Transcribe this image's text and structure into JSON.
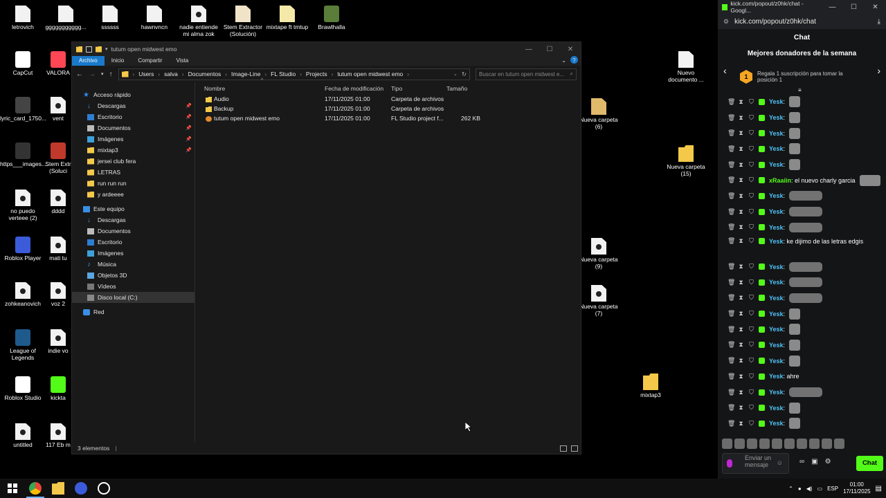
{
  "desktop": {
    "icons": [
      "letrovich",
      "ggggggggggg...",
      "ssssss",
      "hawnvncn",
      "nadie entiende mi alma zok",
      "Stem Extractor (Solución)",
      "mixtape ft tmtup",
      "Brawlhalla",
      "CapCut",
      "VALORA",
      "lyric_card_1750...",
      "vent",
      "https___images....",
      "Stem Extr (Soluci",
      "no puedo verteee (2)",
      "dddd",
      "Roblox Player",
      "mati tu",
      "zohkeanovich",
      "voz 2",
      "League of Legends",
      "indie vo",
      "Roblox Studio",
      "kickta",
      "untitled",
      "117 Eb m",
      "Nueva carpeta (6)",
      "Nuevo documento ...",
      "Nueva carpeta (15)",
      "Nueva carpeta (9)",
      "Nueva carpeta (7)",
      "mixtap3"
    ]
  },
  "explorer": {
    "title": "tutum open midwest emo",
    "ribbon": [
      "Archivo",
      "Inicio",
      "Compartir",
      "Vista"
    ],
    "path": [
      "Users",
      "salva",
      "Documentos",
      "Image-Line",
      "FL Studio",
      "Projects",
      "tutum open midwest emo"
    ],
    "search_placeholder": "Buscar en tutum open midwest e...",
    "nav": {
      "quick_access": "Acceso rápido",
      "quick_items": [
        "Descargas",
        "Escritorio",
        "Documentos",
        "Imágenes",
        "mixtap3",
        "jersei club fera",
        "LETRAS",
        "run run run",
        "y ardeeee"
      ],
      "this_pc": "Este equipo",
      "pc_items": [
        "Descargas",
        "Documentos",
        "Escritorio",
        "Imágenes",
        "Música",
        "Objetos 3D",
        "Vídeos",
        "Disco local (C:)"
      ],
      "network": "Red"
    },
    "columns": [
      "Nombre",
      "Fecha de modificación",
      "Tipo",
      "Tamaño"
    ],
    "files": [
      {
        "name": "Audio",
        "date": "17/11/2025 01:00",
        "type": "Carpeta de archivos",
        "size": ""
      },
      {
        "name": "Backup",
        "date": "17/11/2025 01:00",
        "type": "Carpeta de archivos",
        "size": ""
      },
      {
        "name": "tutum open midwest emo",
        "date": "17/11/2025 01:00",
        "type": "FL Studio project f...",
        "size": "262 KB"
      }
    ],
    "status": "3 elementos"
  },
  "chat": {
    "window_title": "kick.com/popout/z0hk/chat - Googl...",
    "url": "kick.com/popout/z0hk/chat",
    "header": "Chat",
    "donors_title": "Mejores donadores de la semana",
    "donor_rank": "1",
    "donor_prompt": "Regala 1 suscripción para tomar la posición 1",
    "messages": [
      {
        "user": "Yesk",
        "text": ":"
      },
      {
        "user": "Yesk",
        "text": ":"
      },
      {
        "user": "Yesk",
        "text": ":"
      },
      {
        "user": "Yesk",
        "text": ":"
      },
      {
        "user": "Yesk",
        "text": ":"
      },
      {
        "user": "xRaaiin",
        "text": ": el nuevo charly garcia"
      },
      {
        "user": "Yesk",
        "text": ":"
      },
      {
        "user": "Yesk",
        "text": ":"
      },
      {
        "user": "Yesk",
        "text": ":"
      },
      {
        "user": "Yesk",
        "text": ": ke dijimo de las letras edgis"
      },
      {
        "user": "Yesk",
        "text": ":"
      },
      {
        "user": "Yesk",
        "text": ":"
      },
      {
        "user": "Yesk",
        "text": ":"
      },
      {
        "user": "Yesk",
        "text": ":"
      },
      {
        "user": "Yesk",
        "text": ":"
      },
      {
        "user": "Yesk",
        "text": ":"
      },
      {
        "user": "Yesk",
        "text": ":"
      },
      {
        "user": "Yesk",
        "text": ": ahre"
      },
      {
        "user": "Yesk",
        "text": ":"
      },
      {
        "user": "Yesk",
        "text": ":"
      },
      {
        "user": "Yesk",
        "text": ":"
      }
    ],
    "input_placeholder": "Enviar un mensaje",
    "send_label": "Chat",
    "colors": {
      "accent": "#53fc18",
      "yesk": "#4fc3f7",
      "xraaiin": "#53fc18"
    }
  },
  "taskbar": {
    "lang": "ESP",
    "time": "01:00",
    "date": "17/11/2025"
  }
}
